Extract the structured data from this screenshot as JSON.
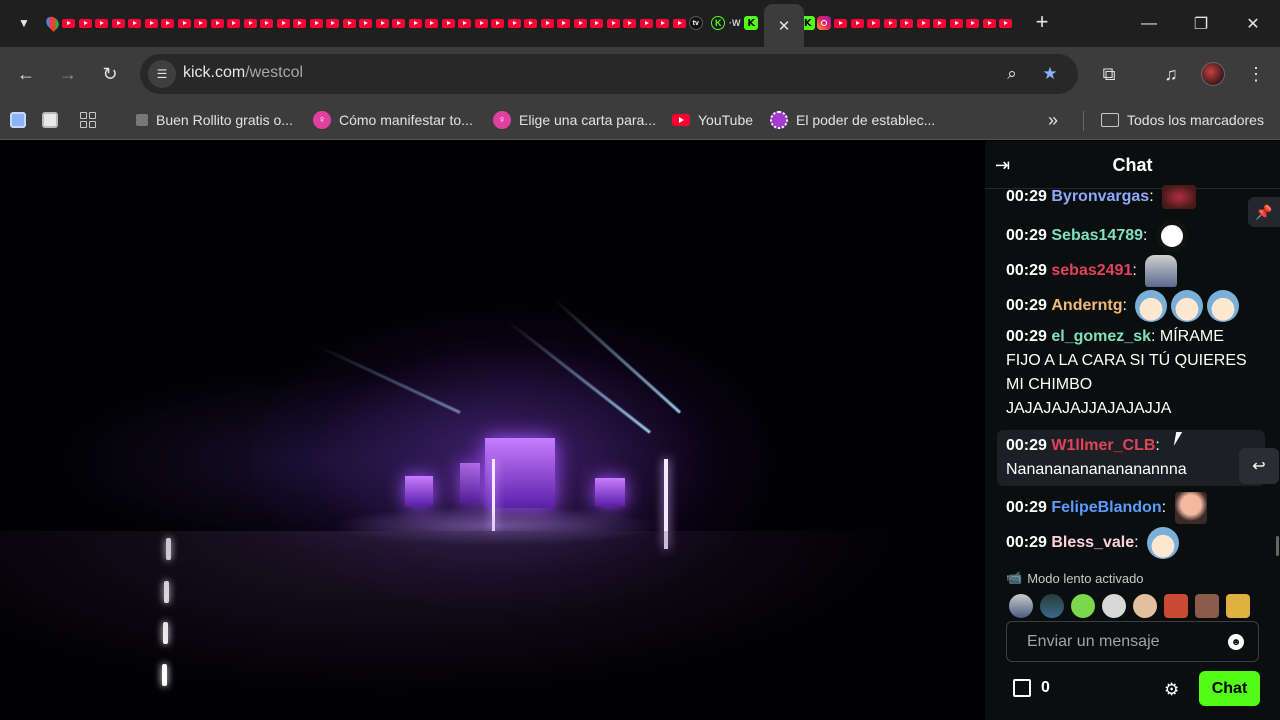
{
  "browser": {
    "url_host": "kick.com",
    "url_path": "/westcol",
    "tab_close_glyph": "✕",
    "new_tab_glyph": "+",
    "bookmarks": [
      {
        "label": "Buen Rollito gratis o...",
        "icon": "grid-favicon"
      },
      {
        "label": "Cómo manifestar to...",
        "icon": "pink-favicon"
      },
      {
        "label": "Elige una carta para...",
        "icon": "pink-favicon"
      },
      {
        "label": "YouTube",
        "icon": "youtube-favicon"
      },
      {
        "label": "El poder de establec...",
        "icon": "flower-favicon"
      }
    ],
    "bookmarks_more": "»",
    "all_bookmarks": "Todos los marcadores"
  },
  "chat": {
    "title": "Chat",
    "messages": [
      {
        "time": "00:29",
        "user": "Byronvargas",
        "color": "#8fa8ff",
        "text": "",
        "emotes": [
          "lips-emote"
        ]
      },
      {
        "time": "00:29",
        "user": "Sebas14789",
        "color": "#7fe0c0",
        "text": "",
        "emotes": [
          "badge-emote"
        ]
      },
      {
        "time": "00:29",
        "user": "sebas2491",
        "color": "#e0435a",
        "text": "",
        "emotes": [
          "dancer-emote"
        ]
      },
      {
        "time": "00:29",
        "user": "Anderntg",
        "color": "#f0b87a",
        "text": "",
        "emotes": [
          "face-emote",
          "face-emote",
          "face-emote"
        ]
      },
      {
        "time": "00:29",
        "user": "el_gomez_sk",
        "color": "#7fe0c0",
        "text": "MÍRAME FIJO A LA CARA SI TÚ QUIERES MI CHIMBO JAJAJAJAJJAJAJAJJA",
        "emotes": []
      },
      {
        "time": "00:29",
        "user": "W1llmer_CLB",
        "color": "#e0435a",
        "text": "Nanananananananannna",
        "emotes": []
      },
      {
        "time": "00:29",
        "user": "FelipeBlandon",
        "color": "#5a9cff",
        "text": "",
        "emotes": [
          "man-emote"
        ]
      },
      {
        "time": "00:29",
        "user": "Bless_vale",
        "color": "#ffd0e0",
        "text": "",
        "emotes": [
          "face-emote"
        ]
      }
    ],
    "slow_mode": "Modo lento activado",
    "input_placeholder": "Enviar un mensaje",
    "points": "0",
    "send_label": "Chat",
    "accent": "#53fc18"
  }
}
